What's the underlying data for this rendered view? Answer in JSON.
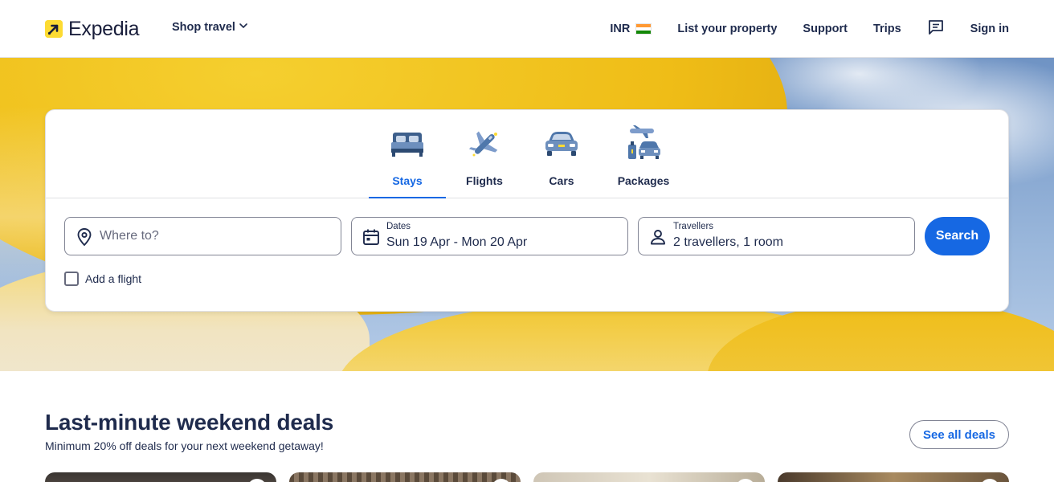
{
  "header": {
    "logo_text": "Expedia",
    "shop_travel": "Shop travel",
    "currency": "INR",
    "list_property": "List your property",
    "support": "Support",
    "trips": "Trips",
    "sign_in": "Sign in"
  },
  "tabs": [
    {
      "label": "Stays",
      "icon": "bed-icon",
      "active": true
    },
    {
      "label": "Flights",
      "icon": "plane-icon",
      "active": false
    },
    {
      "label": "Cars",
      "icon": "car-icon",
      "active": false
    },
    {
      "label": "Packages",
      "icon": "packages-icon",
      "active": false
    }
  ],
  "search": {
    "destination_placeholder": "Where to?",
    "dates_label": "Dates",
    "dates_value": "Sun 19 Apr - Mon 20 Apr",
    "travellers_label": "Travellers",
    "travellers_value": "2 travellers, 1 room",
    "button": "Search",
    "add_flight": "Add a flight"
  },
  "deals": {
    "title": "Last-minute weekend deals",
    "subtitle": "Minimum 20% off deals for your next weekend getaway!",
    "see_all": "See all deals"
  },
  "colors": {
    "accent": "#1668e3",
    "logo_yellow": "#fddb32",
    "text": "#1f2b4d"
  }
}
